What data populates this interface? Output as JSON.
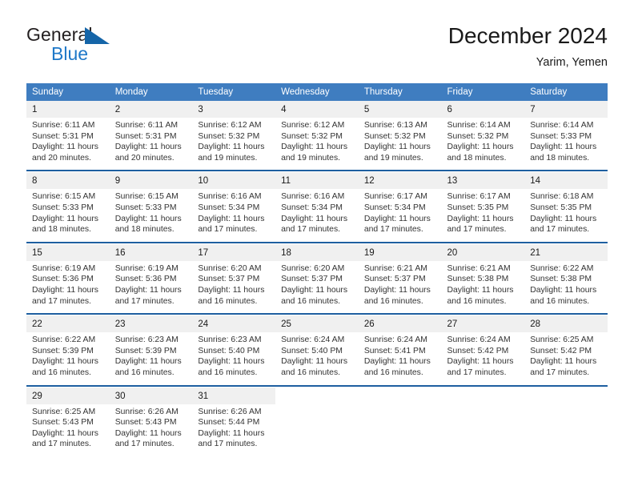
{
  "brand": {
    "name_part1": "General",
    "name_part2": "Blue",
    "triangle_icon": "blue-triangle-icon",
    "accent_color": "#1e78c8",
    "dark_color": "#231f20"
  },
  "header": {
    "title": "December 2024",
    "location": "Yarim, Yemen"
  },
  "calendar": {
    "header_bg": "#3f7dc0",
    "separator_color": "#1e5fa0",
    "daynum_bg": "#f0f0f0",
    "weekday_headers": [
      "Sunday",
      "Monday",
      "Tuesday",
      "Wednesday",
      "Thursday",
      "Friday",
      "Saturday"
    ],
    "weeks": [
      [
        {
          "day": "1",
          "sunrise": "Sunrise: 6:11 AM",
          "sunset": "Sunset: 5:31 PM",
          "daylight_line1": "Daylight: 11 hours",
          "daylight_line2": "and 20 minutes."
        },
        {
          "day": "2",
          "sunrise": "Sunrise: 6:11 AM",
          "sunset": "Sunset: 5:31 PM",
          "daylight_line1": "Daylight: 11 hours",
          "daylight_line2": "and 20 minutes."
        },
        {
          "day": "3",
          "sunrise": "Sunrise: 6:12 AM",
          "sunset": "Sunset: 5:32 PM",
          "daylight_line1": "Daylight: 11 hours",
          "daylight_line2": "and 19 minutes."
        },
        {
          "day": "4",
          "sunrise": "Sunrise: 6:12 AM",
          "sunset": "Sunset: 5:32 PM",
          "daylight_line1": "Daylight: 11 hours",
          "daylight_line2": "and 19 minutes."
        },
        {
          "day": "5",
          "sunrise": "Sunrise: 6:13 AM",
          "sunset": "Sunset: 5:32 PM",
          "daylight_line1": "Daylight: 11 hours",
          "daylight_line2": "and 19 minutes."
        },
        {
          "day": "6",
          "sunrise": "Sunrise: 6:14 AM",
          "sunset": "Sunset: 5:32 PM",
          "daylight_line1": "Daylight: 11 hours",
          "daylight_line2": "and 18 minutes."
        },
        {
          "day": "7",
          "sunrise": "Sunrise: 6:14 AM",
          "sunset": "Sunset: 5:33 PM",
          "daylight_line1": "Daylight: 11 hours",
          "daylight_line2": "and 18 minutes."
        }
      ],
      [
        {
          "day": "8",
          "sunrise": "Sunrise: 6:15 AM",
          "sunset": "Sunset: 5:33 PM",
          "daylight_line1": "Daylight: 11 hours",
          "daylight_line2": "and 18 minutes."
        },
        {
          "day": "9",
          "sunrise": "Sunrise: 6:15 AM",
          "sunset": "Sunset: 5:33 PM",
          "daylight_line1": "Daylight: 11 hours",
          "daylight_line2": "and 18 minutes."
        },
        {
          "day": "10",
          "sunrise": "Sunrise: 6:16 AM",
          "sunset": "Sunset: 5:34 PM",
          "daylight_line1": "Daylight: 11 hours",
          "daylight_line2": "and 17 minutes."
        },
        {
          "day": "11",
          "sunrise": "Sunrise: 6:16 AM",
          "sunset": "Sunset: 5:34 PM",
          "daylight_line1": "Daylight: 11 hours",
          "daylight_line2": "and 17 minutes."
        },
        {
          "day": "12",
          "sunrise": "Sunrise: 6:17 AM",
          "sunset": "Sunset: 5:34 PM",
          "daylight_line1": "Daylight: 11 hours",
          "daylight_line2": "and 17 minutes."
        },
        {
          "day": "13",
          "sunrise": "Sunrise: 6:17 AM",
          "sunset": "Sunset: 5:35 PM",
          "daylight_line1": "Daylight: 11 hours",
          "daylight_line2": "and 17 minutes."
        },
        {
          "day": "14",
          "sunrise": "Sunrise: 6:18 AM",
          "sunset": "Sunset: 5:35 PM",
          "daylight_line1": "Daylight: 11 hours",
          "daylight_line2": "and 17 minutes."
        }
      ],
      [
        {
          "day": "15",
          "sunrise": "Sunrise: 6:19 AM",
          "sunset": "Sunset: 5:36 PM",
          "daylight_line1": "Daylight: 11 hours",
          "daylight_line2": "and 17 minutes."
        },
        {
          "day": "16",
          "sunrise": "Sunrise: 6:19 AM",
          "sunset": "Sunset: 5:36 PM",
          "daylight_line1": "Daylight: 11 hours",
          "daylight_line2": "and 17 minutes."
        },
        {
          "day": "17",
          "sunrise": "Sunrise: 6:20 AM",
          "sunset": "Sunset: 5:37 PM",
          "daylight_line1": "Daylight: 11 hours",
          "daylight_line2": "and 16 minutes."
        },
        {
          "day": "18",
          "sunrise": "Sunrise: 6:20 AM",
          "sunset": "Sunset: 5:37 PM",
          "daylight_line1": "Daylight: 11 hours",
          "daylight_line2": "and 16 minutes."
        },
        {
          "day": "19",
          "sunrise": "Sunrise: 6:21 AM",
          "sunset": "Sunset: 5:37 PM",
          "daylight_line1": "Daylight: 11 hours",
          "daylight_line2": "and 16 minutes."
        },
        {
          "day": "20",
          "sunrise": "Sunrise: 6:21 AM",
          "sunset": "Sunset: 5:38 PM",
          "daylight_line1": "Daylight: 11 hours",
          "daylight_line2": "and 16 minutes."
        },
        {
          "day": "21",
          "sunrise": "Sunrise: 6:22 AM",
          "sunset": "Sunset: 5:38 PM",
          "daylight_line1": "Daylight: 11 hours",
          "daylight_line2": "and 16 minutes."
        }
      ],
      [
        {
          "day": "22",
          "sunrise": "Sunrise: 6:22 AM",
          "sunset": "Sunset: 5:39 PM",
          "daylight_line1": "Daylight: 11 hours",
          "daylight_line2": "and 16 minutes."
        },
        {
          "day": "23",
          "sunrise": "Sunrise: 6:23 AM",
          "sunset": "Sunset: 5:39 PM",
          "daylight_line1": "Daylight: 11 hours",
          "daylight_line2": "and 16 minutes."
        },
        {
          "day": "24",
          "sunrise": "Sunrise: 6:23 AM",
          "sunset": "Sunset: 5:40 PM",
          "daylight_line1": "Daylight: 11 hours",
          "daylight_line2": "and 16 minutes."
        },
        {
          "day": "25",
          "sunrise": "Sunrise: 6:24 AM",
          "sunset": "Sunset: 5:40 PM",
          "daylight_line1": "Daylight: 11 hours",
          "daylight_line2": "and 16 minutes."
        },
        {
          "day": "26",
          "sunrise": "Sunrise: 6:24 AM",
          "sunset": "Sunset: 5:41 PM",
          "daylight_line1": "Daylight: 11 hours",
          "daylight_line2": "and 16 minutes."
        },
        {
          "day": "27",
          "sunrise": "Sunrise: 6:24 AM",
          "sunset": "Sunset: 5:42 PM",
          "daylight_line1": "Daylight: 11 hours",
          "daylight_line2": "and 17 minutes."
        },
        {
          "day": "28",
          "sunrise": "Sunrise: 6:25 AM",
          "sunset": "Sunset: 5:42 PM",
          "daylight_line1": "Daylight: 11 hours",
          "daylight_line2": "and 17 minutes."
        }
      ],
      [
        {
          "day": "29",
          "sunrise": "Sunrise: 6:25 AM",
          "sunset": "Sunset: 5:43 PM",
          "daylight_line1": "Daylight: 11 hours",
          "daylight_line2": "and 17 minutes."
        },
        {
          "day": "30",
          "sunrise": "Sunrise: 6:26 AM",
          "sunset": "Sunset: 5:43 PM",
          "daylight_line1": "Daylight: 11 hours",
          "daylight_line2": "and 17 minutes."
        },
        {
          "day": "31",
          "sunrise": "Sunrise: 6:26 AM",
          "sunset": "Sunset: 5:44 PM",
          "daylight_line1": "Daylight: 11 hours",
          "daylight_line2": "and 17 minutes."
        },
        {
          "day": "",
          "sunrise": "",
          "sunset": "",
          "daylight_line1": "",
          "daylight_line2": ""
        },
        {
          "day": "",
          "sunrise": "",
          "sunset": "",
          "daylight_line1": "",
          "daylight_line2": ""
        },
        {
          "day": "",
          "sunrise": "",
          "sunset": "",
          "daylight_line1": "",
          "daylight_line2": ""
        },
        {
          "day": "",
          "sunrise": "",
          "sunset": "",
          "daylight_line1": "",
          "daylight_line2": ""
        }
      ]
    ]
  }
}
